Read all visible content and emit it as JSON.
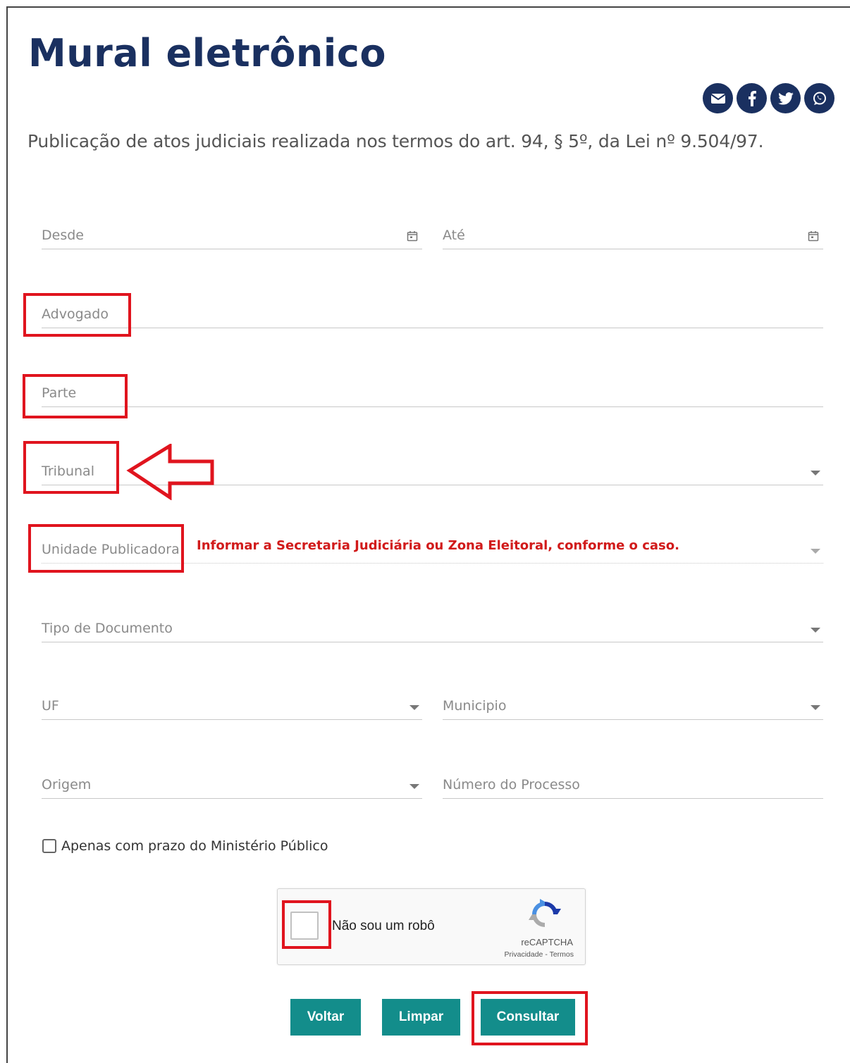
{
  "page": {
    "title": "Mural eletrônico",
    "subtitle": "Publicação de atos judiciais realizada nos termos do art. 94, § 5º, da Lei nº 9.504/97.",
    "brand_color": "#1a3060",
    "accent_color": "#138d8b",
    "highlight_color": "#e0141e"
  },
  "share": {
    "icons": [
      "envelope-icon",
      "facebook-icon",
      "twitter-icon",
      "whatsapp-icon"
    ]
  },
  "form": {
    "desde": {
      "label": "Desde"
    },
    "ate": {
      "label": "Até"
    },
    "advogado": {
      "label": "Advogado"
    },
    "parte": {
      "label": "Parte"
    },
    "tribunal": {
      "label": "Tribunal"
    },
    "unidade": {
      "label": "Unidade Publicadora",
      "hint": "Informar a Secretaria Judiciária ou Zona Eleitoral, conforme o caso."
    },
    "tipo_documento": {
      "label": "Tipo de Documento"
    },
    "uf": {
      "label": "UF"
    },
    "municipio": {
      "label": "Municipio"
    },
    "origem": {
      "label": "Origem"
    },
    "numero_processo": {
      "label": "Número do Processo"
    },
    "ministerio_publico": {
      "label": "Apenas com prazo do Ministério Público",
      "checked": false
    }
  },
  "captcha": {
    "label": "Não sou um robô",
    "brand": "reCAPTCHA",
    "privacy": "Privacidade",
    "separator": " - ",
    "terms": "Termos"
  },
  "buttons": {
    "voltar": "Voltar",
    "limpar": "Limpar",
    "consultar": "Consultar"
  }
}
